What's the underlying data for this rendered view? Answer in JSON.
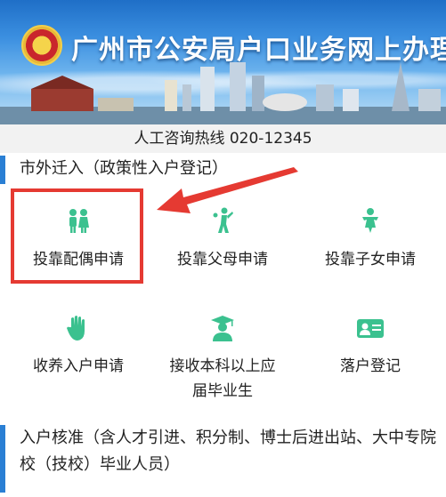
{
  "banner": {
    "title": "广州市公安局户口业务网上办理"
  },
  "hotline": {
    "text": "人工咨询热线 020-12345"
  },
  "sections": [
    {
      "title": "市外迁入（政策性入户登记）"
    },
    {
      "title": "入户核准（含人才引进、积分制、博士后进出站、大中专院校（技校）毕业人员）"
    }
  ],
  "items": [
    {
      "label": "投靠配偶申请",
      "icon": "couple-icon"
    },
    {
      "label": "投靠父母申请",
      "icon": "parent-child-icon"
    },
    {
      "label": "投靠子女申请",
      "icon": "child-icon"
    },
    {
      "label": "收养入户申请",
      "icon": "hand-icon"
    },
    {
      "label": "接收本科以上应届毕业生",
      "icon": "graduate-icon"
    },
    {
      "label": "落户登记",
      "icon": "id-card-icon"
    }
  ],
  "colors": {
    "accent": "#2a7fd4",
    "icon": "#3bc18f",
    "highlight": "#e53a32"
  }
}
